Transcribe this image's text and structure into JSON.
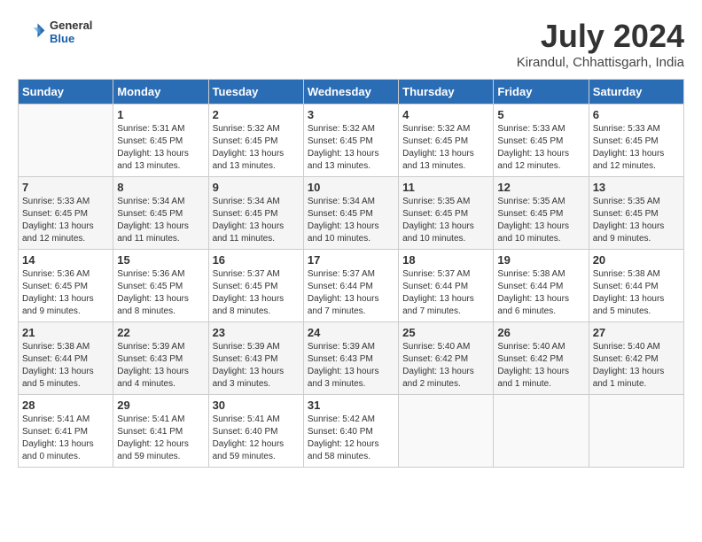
{
  "header": {
    "logo_general": "General",
    "logo_blue": "Blue",
    "month": "July 2024",
    "location": "Kirandul, Chhattisgarh, India"
  },
  "days_of_week": [
    "Sunday",
    "Monday",
    "Tuesday",
    "Wednesday",
    "Thursday",
    "Friday",
    "Saturday"
  ],
  "weeks": [
    [
      {
        "day": "",
        "info": ""
      },
      {
        "day": "1",
        "info": "Sunrise: 5:31 AM\nSunset: 6:45 PM\nDaylight: 13 hours\nand 13 minutes."
      },
      {
        "day": "2",
        "info": "Sunrise: 5:32 AM\nSunset: 6:45 PM\nDaylight: 13 hours\nand 13 minutes."
      },
      {
        "day": "3",
        "info": "Sunrise: 5:32 AM\nSunset: 6:45 PM\nDaylight: 13 hours\nand 13 minutes."
      },
      {
        "day": "4",
        "info": "Sunrise: 5:32 AM\nSunset: 6:45 PM\nDaylight: 13 hours\nand 13 minutes."
      },
      {
        "day": "5",
        "info": "Sunrise: 5:33 AM\nSunset: 6:45 PM\nDaylight: 13 hours\nand 12 minutes."
      },
      {
        "day": "6",
        "info": "Sunrise: 5:33 AM\nSunset: 6:45 PM\nDaylight: 13 hours\nand 12 minutes."
      }
    ],
    [
      {
        "day": "7",
        "info": "Sunrise: 5:33 AM\nSunset: 6:45 PM\nDaylight: 13 hours\nand 12 minutes."
      },
      {
        "day": "8",
        "info": "Sunrise: 5:34 AM\nSunset: 6:45 PM\nDaylight: 13 hours\nand 11 minutes."
      },
      {
        "day": "9",
        "info": "Sunrise: 5:34 AM\nSunset: 6:45 PM\nDaylight: 13 hours\nand 11 minutes."
      },
      {
        "day": "10",
        "info": "Sunrise: 5:34 AM\nSunset: 6:45 PM\nDaylight: 13 hours\nand 10 minutes."
      },
      {
        "day": "11",
        "info": "Sunrise: 5:35 AM\nSunset: 6:45 PM\nDaylight: 13 hours\nand 10 minutes."
      },
      {
        "day": "12",
        "info": "Sunrise: 5:35 AM\nSunset: 6:45 PM\nDaylight: 13 hours\nand 10 minutes."
      },
      {
        "day": "13",
        "info": "Sunrise: 5:35 AM\nSunset: 6:45 PM\nDaylight: 13 hours\nand 9 minutes."
      }
    ],
    [
      {
        "day": "14",
        "info": "Sunrise: 5:36 AM\nSunset: 6:45 PM\nDaylight: 13 hours\nand 9 minutes."
      },
      {
        "day": "15",
        "info": "Sunrise: 5:36 AM\nSunset: 6:45 PM\nDaylight: 13 hours\nand 8 minutes."
      },
      {
        "day": "16",
        "info": "Sunrise: 5:37 AM\nSunset: 6:45 PM\nDaylight: 13 hours\nand 8 minutes."
      },
      {
        "day": "17",
        "info": "Sunrise: 5:37 AM\nSunset: 6:44 PM\nDaylight: 13 hours\nand 7 minutes."
      },
      {
        "day": "18",
        "info": "Sunrise: 5:37 AM\nSunset: 6:44 PM\nDaylight: 13 hours\nand 7 minutes."
      },
      {
        "day": "19",
        "info": "Sunrise: 5:38 AM\nSunset: 6:44 PM\nDaylight: 13 hours\nand 6 minutes."
      },
      {
        "day": "20",
        "info": "Sunrise: 5:38 AM\nSunset: 6:44 PM\nDaylight: 13 hours\nand 5 minutes."
      }
    ],
    [
      {
        "day": "21",
        "info": "Sunrise: 5:38 AM\nSunset: 6:44 PM\nDaylight: 13 hours\nand 5 minutes."
      },
      {
        "day": "22",
        "info": "Sunrise: 5:39 AM\nSunset: 6:43 PM\nDaylight: 13 hours\nand 4 minutes."
      },
      {
        "day": "23",
        "info": "Sunrise: 5:39 AM\nSunset: 6:43 PM\nDaylight: 13 hours\nand 3 minutes."
      },
      {
        "day": "24",
        "info": "Sunrise: 5:39 AM\nSunset: 6:43 PM\nDaylight: 13 hours\nand 3 minutes."
      },
      {
        "day": "25",
        "info": "Sunrise: 5:40 AM\nSunset: 6:42 PM\nDaylight: 13 hours\nand 2 minutes."
      },
      {
        "day": "26",
        "info": "Sunrise: 5:40 AM\nSunset: 6:42 PM\nDaylight: 13 hours\nand 1 minute."
      },
      {
        "day": "27",
        "info": "Sunrise: 5:40 AM\nSunset: 6:42 PM\nDaylight: 13 hours\nand 1 minute."
      }
    ],
    [
      {
        "day": "28",
        "info": "Sunrise: 5:41 AM\nSunset: 6:41 PM\nDaylight: 13 hours\nand 0 minutes."
      },
      {
        "day": "29",
        "info": "Sunrise: 5:41 AM\nSunset: 6:41 PM\nDaylight: 12 hours\nand 59 minutes."
      },
      {
        "day": "30",
        "info": "Sunrise: 5:41 AM\nSunset: 6:40 PM\nDaylight: 12 hours\nand 59 minutes."
      },
      {
        "day": "31",
        "info": "Sunrise: 5:42 AM\nSunset: 6:40 PM\nDaylight: 12 hours\nand 58 minutes."
      },
      {
        "day": "",
        "info": ""
      },
      {
        "day": "",
        "info": ""
      },
      {
        "day": "",
        "info": ""
      }
    ]
  ]
}
